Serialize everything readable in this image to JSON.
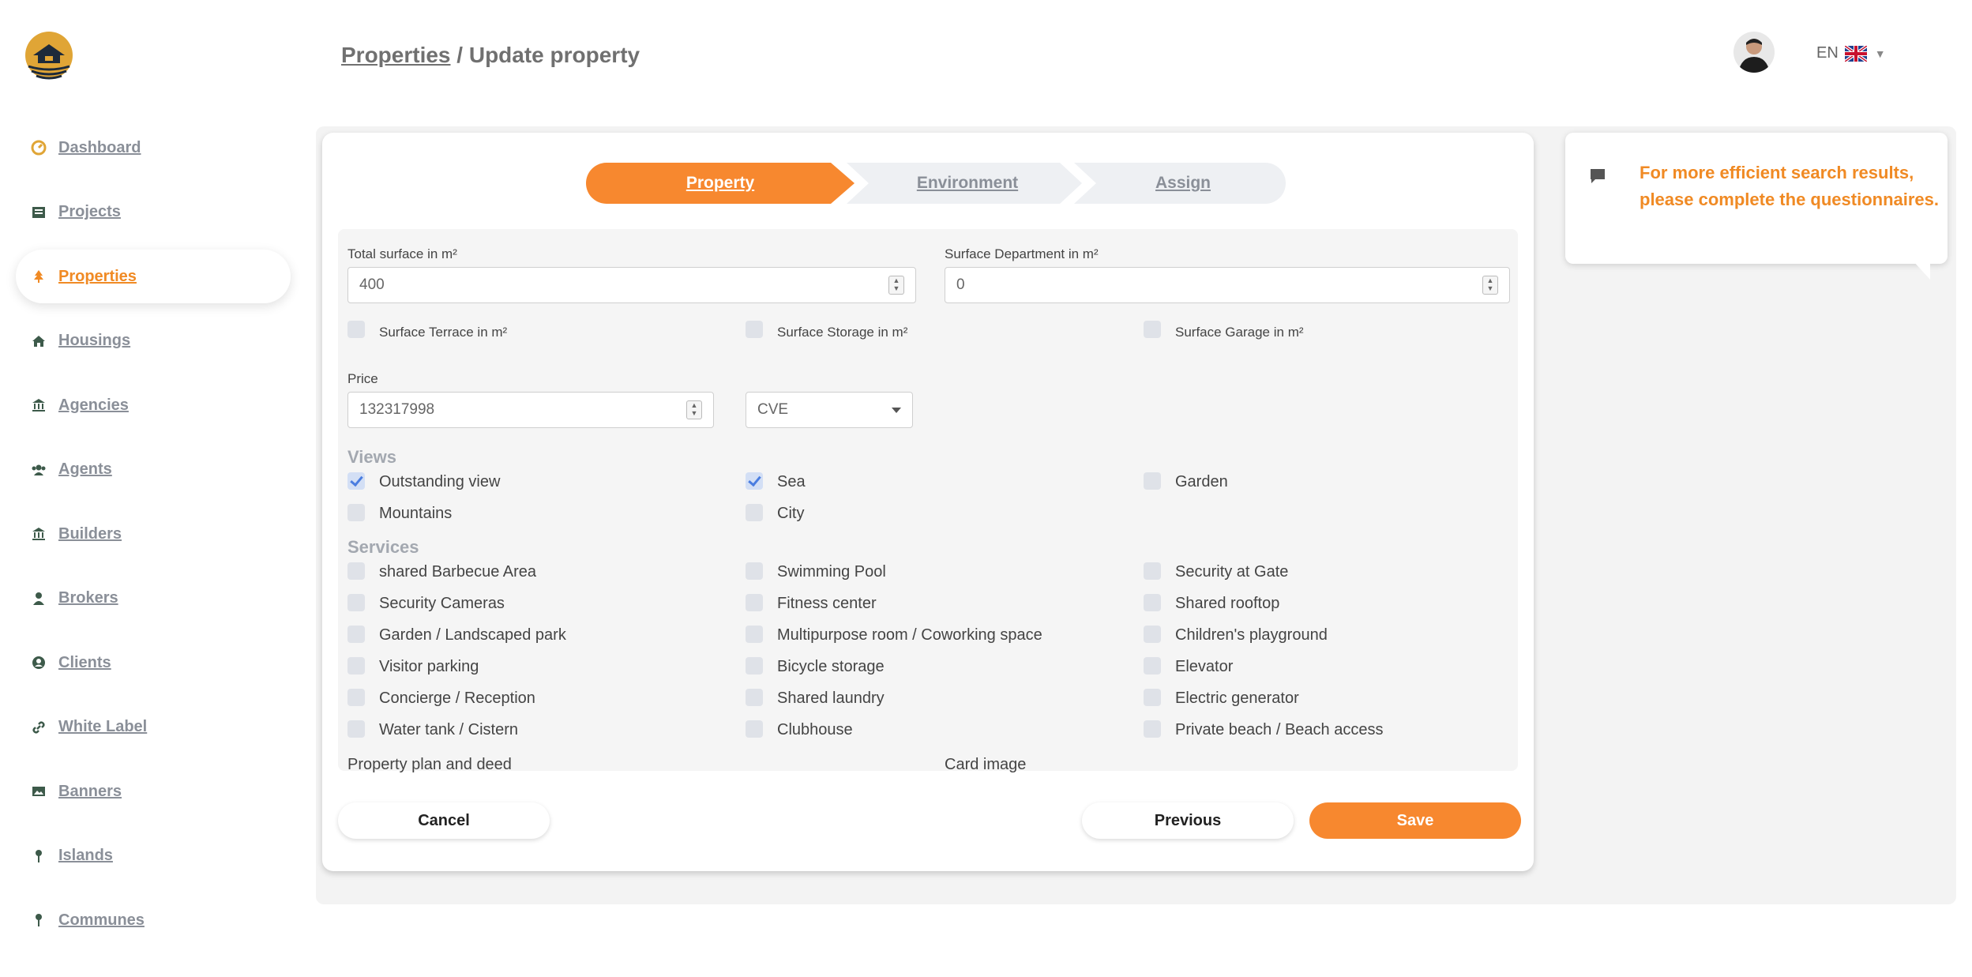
{
  "colors": {
    "accent": "#f7882f",
    "accent_text": "#f08a24",
    "muted": "#8a8f98"
  },
  "sidebar": {
    "items": [
      {
        "label": "Dashboard",
        "icon": "gauge-icon"
      },
      {
        "label": "Projects",
        "icon": "list-icon"
      },
      {
        "label": "Properties",
        "icon": "tree-icon",
        "active": true
      },
      {
        "label": "Housings",
        "icon": "home-icon"
      },
      {
        "label": "Agencies",
        "icon": "bank-icon"
      },
      {
        "label": "Agents",
        "icon": "users-icon"
      },
      {
        "label": "Builders",
        "icon": "bank-icon"
      },
      {
        "label": "Brokers",
        "icon": "user-icon"
      },
      {
        "label": "Clients",
        "icon": "user-circle-icon"
      },
      {
        "label": "White Label",
        "icon": "link-icon"
      },
      {
        "label": "Banners",
        "icon": "image-icon"
      },
      {
        "label": "Islands",
        "icon": "pin-icon"
      },
      {
        "label": "Communes",
        "icon": "pin-icon"
      }
    ]
  },
  "header": {
    "breadcrumb_link": "Properties",
    "breadcrumb_sep": " / ",
    "breadcrumb_current": "Update property",
    "language": "EN"
  },
  "steps": [
    "Property",
    "Environment",
    "Assign"
  ],
  "form": {
    "total_surface_label": "Total surface in m²",
    "total_surface_value": "400",
    "surface_department_label": "Surface Department in m²",
    "surface_department_value": "0",
    "optional_surfaces": [
      "Surface Terrace in m²",
      "Surface Storage in m²",
      "Surface Garage in m²"
    ],
    "price_label": "Price",
    "price_value": "132317998",
    "currency": "CVE",
    "views_title": "Views",
    "views": [
      {
        "label": "Outstanding view",
        "checked": true
      },
      {
        "label": "Sea",
        "checked": true
      },
      {
        "label": "Garden",
        "checked": false
      },
      {
        "label": "Mountains",
        "checked": false
      },
      {
        "label": "City",
        "checked": false
      }
    ],
    "services_title": "Services",
    "services": [
      "shared Barbecue Area",
      "Swimming Pool",
      "Security at Gate",
      "Security Cameras",
      "Fitness center",
      "Shared rooftop",
      "Garden / Landscaped park",
      "Multipurpose room / Coworking space",
      "Children's playground",
      "Visitor parking",
      "Bicycle storage",
      "Elevator",
      "Concierge / Reception",
      "Shared laundry",
      "Electric generator",
      "Water tank / Cistern",
      "Clubhouse",
      "Private beach / Beach access"
    ],
    "plan_label": "Property plan and deed",
    "card_image_label": "Card image"
  },
  "buttons": {
    "cancel": "Cancel",
    "previous": "Previous",
    "save": "Save"
  },
  "tip": {
    "text": "For more efficient search results, please complete the questionnaires."
  }
}
